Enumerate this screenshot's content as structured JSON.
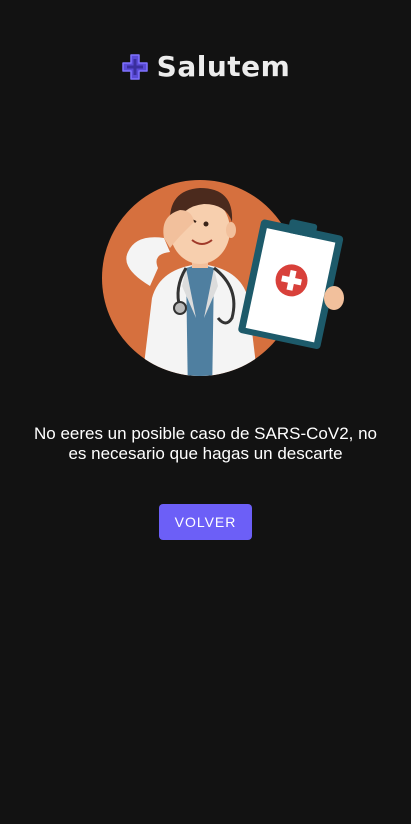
{
  "app": {
    "name": "Salutem",
    "logo_icon": "medical-cross-icon",
    "colors": {
      "background": "#121212",
      "accent": "#6c5ff7",
      "text": "#ffffff"
    }
  },
  "result": {
    "illustration": "doctor-with-clipboard",
    "message": "No eeres un posible caso de SARS-CoV2, no es necesario que hagas un descarte",
    "back_label": "VOLVER"
  }
}
